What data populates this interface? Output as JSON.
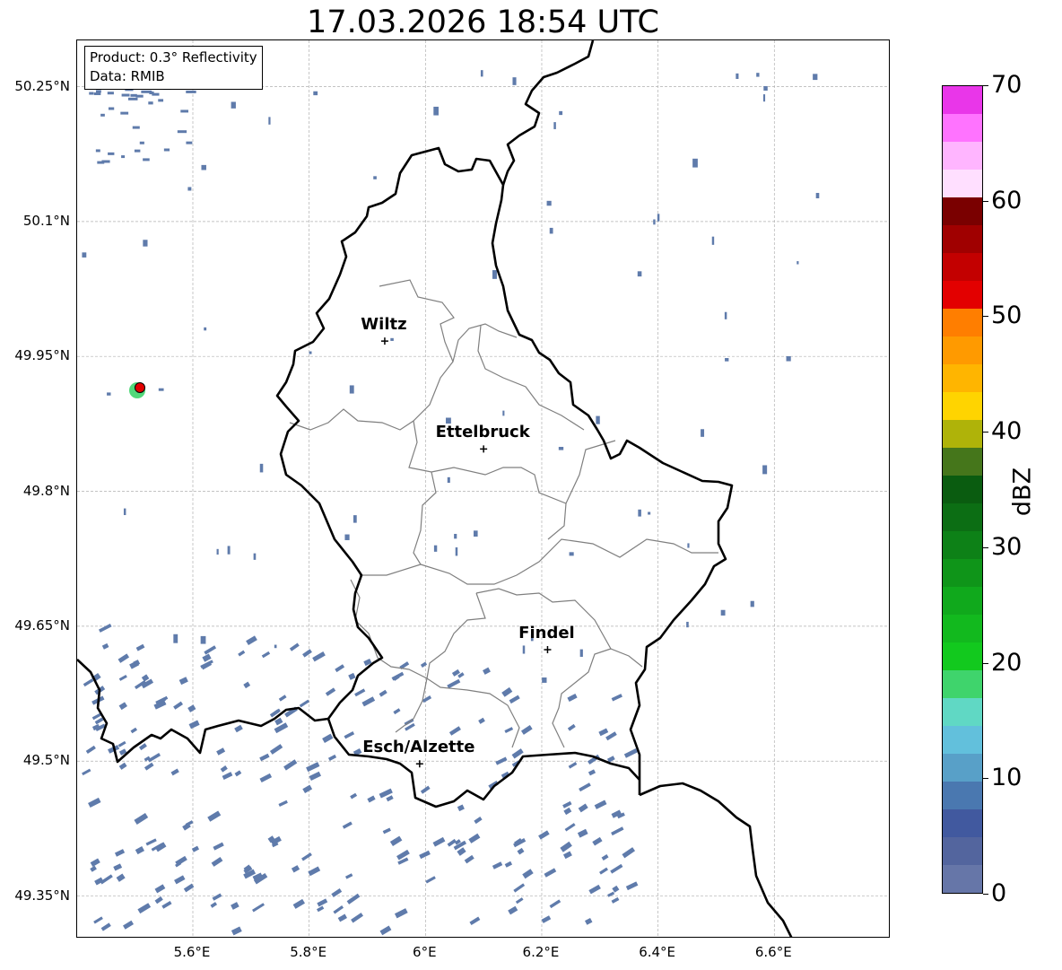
{
  "title": "17.03.2026 18:54 UTC",
  "info": {
    "product": "Product: 0.3° Reflectivity",
    "data": "Data: RMIB"
  },
  "map": {
    "lon_range": [
      5.4,
      6.8
    ],
    "lat_range": [
      49.3,
      50.3
    ],
    "lat_ticks": [
      {
        "value": 50.25,
        "label": "50.25°N"
      },
      {
        "value": 50.1,
        "label": "50.1°N"
      },
      {
        "value": 49.95,
        "label": "49.95°N"
      },
      {
        "value": 49.8,
        "label": "49.8°N"
      },
      {
        "value": 49.65,
        "label": "49.65°N"
      },
      {
        "value": 49.5,
        "label": "49.5°N"
      },
      {
        "value": 49.35,
        "label": "49.35°N"
      }
    ],
    "lon_ticks": [
      {
        "value": 5.6,
        "label": "5.6°E"
      },
      {
        "value": 5.8,
        "label": "5.8°E"
      },
      {
        "value": 6.0,
        "label": "6°E"
      },
      {
        "value": 6.2,
        "label": "6.2°E"
      },
      {
        "value": 6.4,
        "label": "6.4°E"
      },
      {
        "value": 6.6,
        "label": "6.6°E"
      }
    ],
    "cities": [
      {
        "name": "Wiltz",
        "lon": 5.93,
        "lat": 49.967
      },
      {
        "name": "Ettelbruck",
        "lon": 6.1,
        "lat": 49.847
      },
      {
        "name": "Findel",
        "lon": 6.21,
        "lat": 49.624
      },
      {
        "name": "Esch/Alzette",
        "lon": 5.99,
        "lat": 49.497
      }
    ],
    "radar_site": {
      "lon": 5.506,
      "lat": 49.914
    },
    "grid": true
  },
  "colorbar": {
    "unit": "dBZ",
    "min": 0,
    "max": 70,
    "step": 2.5,
    "ticks": [
      0,
      10,
      20,
      30,
      40,
      50,
      60,
      70
    ],
    "colors": [
      "#6676a8",
      "#53659e",
      "#41599f",
      "#4a78b0",
      "#58a0c8",
      "#62c0dc",
      "#60d8c4",
      "#3fd46c",
      "#12c91e",
      "#12b91e",
      "#10a91c",
      "#0f9519",
      "#0d8117",
      "#0c6e14",
      "#0a5c10",
      "#45761b",
      "#afb309",
      "#ffd400",
      "#ffb500",
      "#ff9a00",
      "#ff7e00",
      "#e30000",
      "#c30000",
      "#a00000",
      "#7a0000",
      "#ffdfff",
      "#ffb5ff",
      "#ff73ff",
      "#e936e9"
    ]
  },
  "colors": {
    "echo": "#5f7bab",
    "border": "#000000",
    "canton": "#7f7f7f",
    "grid": "#b0b0b0"
  }
}
